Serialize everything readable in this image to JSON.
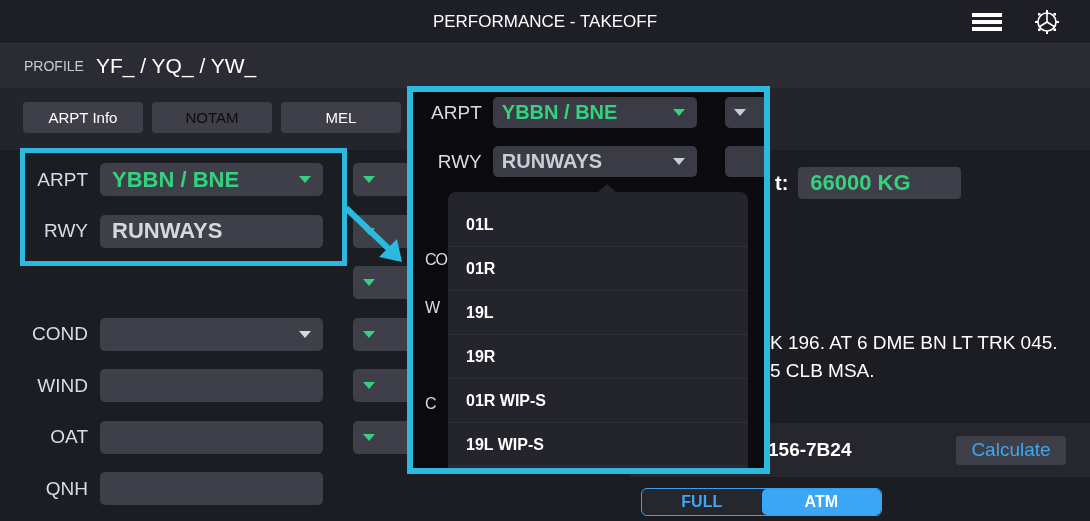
{
  "header": {
    "title": "PERFORMANCE - TAKEOFF"
  },
  "profile": {
    "label": "PROFILE",
    "value": "YF_ / YQ_ / YW_"
  },
  "toolbar": [
    {
      "label": "ARPT Info",
      "disabled": false
    },
    {
      "label": "NOTAM",
      "disabled": true
    },
    {
      "label": "MEL",
      "disabled": false
    }
  ],
  "form": [
    {
      "kind": "select",
      "label": "ARPT",
      "value": "YBBN / BNE",
      "side_dropdown": true
    },
    {
      "kind": "select",
      "label": "RWY",
      "placeholder": "RUNWAYS",
      "side_dropdown": true
    },
    {
      "kind": "none",
      "side_dropdown": true
    },
    {
      "kind": "select",
      "label": "COND",
      "side_dropdown": true
    },
    {
      "kind": "input",
      "label": "WIND",
      "side_dropdown": true
    },
    {
      "kind": "input",
      "label": "OAT",
      "side_dropdown": true
    },
    {
      "kind": "input",
      "label": "QNH",
      "side_dropdown": false
    }
  ],
  "weight": {
    "label": "t:",
    "value": "66000 KG"
  },
  "remarks": [
    "K 196. AT 6 DME BN LT TRK 045.",
    "5 CLB MSA."
  ],
  "footer": {
    "code": "156-7B24",
    "button": "Calculate"
  },
  "mode": [
    {
      "label": "FULL",
      "selected": false
    },
    {
      "label": "ATM",
      "selected": true
    }
  ],
  "callout": {
    "arpt_label": "ARPT",
    "arpt_value": "YBBN / BNE",
    "rwy_label": "RWY",
    "rwy_placeholder": "RUNWAYS",
    "runway_options": [
      "01L",
      "01R",
      "19L",
      "19R",
      "01R WIP-S",
      "19L WIP-S"
    ],
    "hidden_labels": [
      "CO",
      "W",
      "C"
    ]
  }
}
